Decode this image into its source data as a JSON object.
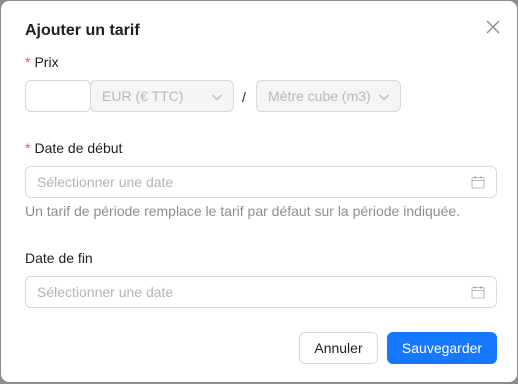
{
  "modal": {
    "title": "Ajouter un tarif"
  },
  "price": {
    "label": "Prix",
    "required_mark": "*",
    "amount_value": "",
    "currency": "EUR (€ TTC)",
    "separator": "/",
    "unit": "Mètre cube (m3)"
  },
  "start_date": {
    "label": "Date de début",
    "required_mark": "*",
    "placeholder": "Sélectionner une date",
    "help": "Un tarif de période remplace le tarif par défaut sur la période indiquée."
  },
  "end_date": {
    "label": "Date de fin",
    "placeholder": "Sélectionner une date"
  },
  "footer": {
    "cancel_label": "Annuler",
    "save_label": "Sauvegarder"
  },
  "icons": {
    "close": "close-icon",
    "dropdown": "chevron-down-icon",
    "calendar": "calendar-icon"
  },
  "colors": {
    "primary": "#1677ff",
    "required": "#ff4d4f",
    "overlay": "#8c8c8c"
  }
}
